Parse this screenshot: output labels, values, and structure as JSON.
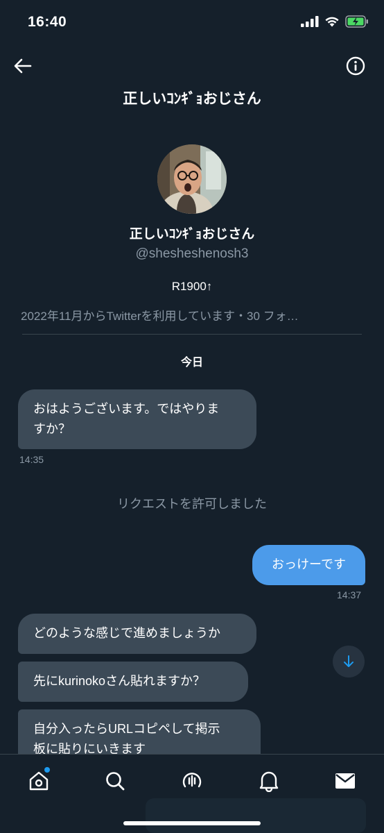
{
  "status_bar": {
    "time": "16:40"
  },
  "header": {
    "title": "正しいｺﾝｷﾞｮおじさん"
  },
  "profile": {
    "name": "正しいｺﾝｷﾞｮおじさん",
    "handle": "@shesheshenosh3",
    "bio": "R1900↑",
    "meta": "2022年11月からTwitterを利用しています・30 フォ…"
  },
  "conversation": {
    "date_label": "今日",
    "messages": [
      {
        "text_line1": "おはようございます。ではやりま",
        "text_line2": "すか？",
        "time": "14:35"
      },
      {
        "system": "リクエストを許可しました"
      },
      {
        "text": "おっけーです",
        "time": "14:37"
      },
      {
        "text": "どのような感じで進めましょうか"
      },
      {
        "text": "先にkurinokoさん貼れますか？"
      },
      {
        "text_line1": "自分入ったらURLコピペして掲示",
        "text_line2": "板に貼りにいきます"
      }
    ]
  },
  "icons": {
    "back": "arrow-left-icon",
    "info": "info-icon",
    "scroll": "arrow-down-icon",
    "tabs": [
      "home-icon",
      "search-icon",
      "spaces-icon",
      "bell-icon",
      "mail-icon"
    ]
  },
  "colors": {
    "background": "#15202b",
    "incoming_bubble": "#3c4a57",
    "outgoing_bubble": "#4c9bea",
    "secondary_text": "#8b98a5",
    "accent": "#1d9bf0"
  }
}
